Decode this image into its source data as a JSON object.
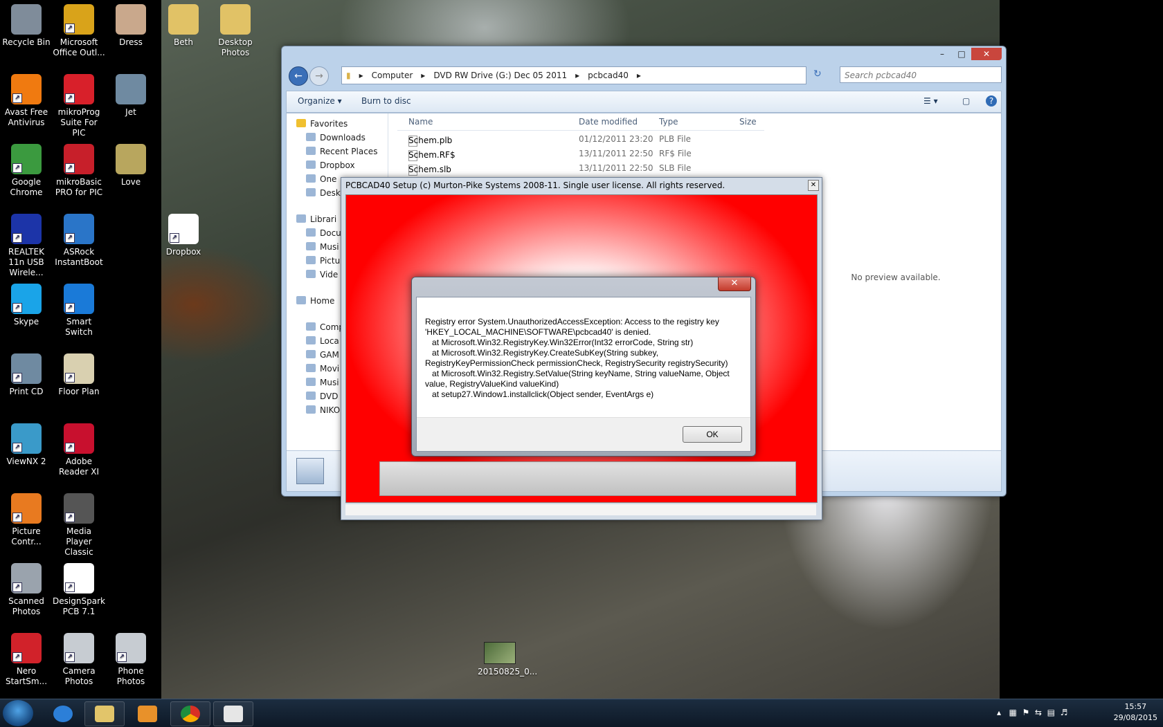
{
  "desktop": {
    "icons": [
      {
        "label": "Recycle Bin",
        "icon": "recycle-bin-icon",
        "color": "#7f8c9a"
      },
      {
        "label": "Microsoft Office Outl...",
        "icon": "outlook-icon",
        "color": "#d9a31a"
      },
      {
        "label": "Dress",
        "icon": "photo-icon",
        "color": "#c9a88c"
      },
      {
        "label": "Beth",
        "icon": "folder-icon",
        "color": "#e1c266"
      },
      {
        "label": "Desktop Photos",
        "icon": "folder-icon",
        "color": "#e1c266"
      },
      {
        "label": "Avast Free Antivirus",
        "icon": "avast-icon",
        "color": "#f07a10"
      },
      {
        "label": "mikroProg Suite For PIC",
        "icon": "mikroprog-icon",
        "color": "#d8202a"
      },
      {
        "label": "Jet",
        "icon": "photo-icon",
        "color": "#6f8aa1"
      },
      {
        "label": "Google Chrome",
        "icon": "chrome-icon",
        "color": "#3b9a3f"
      },
      {
        "label": "mikroBasic PRO for PIC",
        "icon": "mikrobasic-icon",
        "color": "#c71f2a"
      },
      {
        "label": "Love",
        "icon": "photo-icon",
        "color": "#b8a65e"
      },
      {
        "label": "REALTEK 11n USB Wirele...",
        "icon": "realtek-icon",
        "color": "#1c34a8"
      },
      {
        "label": "ASRock InstantBoot",
        "icon": "asrock-icon",
        "color": "#2a75c8"
      },
      {
        "label": "Dropbox",
        "icon": "dropbox-icon",
        "color": "#ffffff"
      },
      {
        "label": "Skype",
        "icon": "skype-icon",
        "color": "#1aa4e8"
      },
      {
        "label": "Smart Switch",
        "icon": "smart-switch-icon",
        "color": "#1a7ad8"
      },
      {
        "label": "Print CD",
        "icon": "print-cd-icon",
        "color": "#6f8aa1"
      },
      {
        "label": "Floor Plan",
        "icon": "floor-plan-icon",
        "color": "#d9d0b0"
      },
      {
        "label": "ViewNX 2",
        "icon": "viewnx-icon",
        "color": "#3a9ac9"
      },
      {
        "label": "Adobe Reader XI",
        "icon": "adobe-reader-icon",
        "color": "#c8102e"
      },
      {
        "label": "Picture Contr...",
        "icon": "picture-control-icon",
        "color": "#e87a20"
      },
      {
        "label": "Media Player Classic",
        "icon": "media-player-icon",
        "color": "#555555"
      },
      {
        "label": "Scanned Photos",
        "icon": "scanner-icon",
        "color": "#9aa3ad"
      },
      {
        "label": "DesignSpark PCB 7.1",
        "icon": "designspark-icon",
        "color": "#ffffff"
      },
      {
        "label": "Nero StartSm...",
        "icon": "nero-icon",
        "color": "#d1222a"
      },
      {
        "label": "Camera Photos",
        "icon": "camera-icon",
        "color": "#c7ccd2"
      },
      {
        "label": "Phone Photos",
        "icon": "camera-icon",
        "color": "#c7ccd2"
      }
    ],
    "video_file": "20150825_0..."
  },
  "explorer": {
    "breadcrumb": [
      "Computer",
      "DVD RW Drive (G:) Dec 05 2011",
      "pcbcad40"
    ],
    "search_placeholder": "Search pcbcad40",
    "toolbar": {
      "organize": "Organize",
      "burn": "Burn to disc"
    },
    "navpane": [
      "Favorites",
      "Downloads",
      "Recent Places",
      "Dropbox",
      "One",
      "Desk",
      "Librari",
      "Docu",
      "Musi",
      "Pictu",
      "Vide",
      "Home",
      "Compu",
      "Loca",
      "GAM",
      "Movi",
      "Musi",
      "DVD",
      "NIKO"
    ],
    "columns": {
      "name": "Name",
      "date": "Date modified",
      "type": "Type",
      "size": "Size"
    },
    "files": [
      {
        "name": "Schem.plb",
        "date": "01/12/2011 23:20",
        "type": "PLB File"
      },
      {
        "name": "Schem.RF$",
        "date": "13/11/2011 22:50",
        "type": "RF$ File"
      },
      {
        "name": "Schem.slb",
        "date": "13/11/2011 22:50",
        "type": "SLB File"
      }
    ],
    "preview": "No preview available."
  },
  "setup": {
    "title": "PCBCAD40 Setup (c) Murton-Pike Systems 2008-11. Single user license. All rights reserved."
  },
  "dialog": {
    "message": "Registry error System.UnauthorizedAccessException: Access to the registry key 'HKEY_LOCAL_MACHINE\\SOFTWARE\\pcbcad40' is denied.\n   at Microsoft.Win32.RegistryKey.Win32Error(Int32 errorCode, String str)\n   at Microsoft.Win32.RegistryKey.CreateSubKey(String subkey, RegistryKeyPermissionCheck permissionCheck, RegistrySecurity registrySecurity)\n   at Microsoft.Win32.Registry.SetValue(String keyName, String valueName, Object value, RegistryValueKind valueKind)\n   at setup27.Window1.installclick(Object sender, EventArgs e)",
    "ok": "OK"
  },
  "taskbar": {
    "time": "15:57",
    "date": "29/08/2015"
  }
}
